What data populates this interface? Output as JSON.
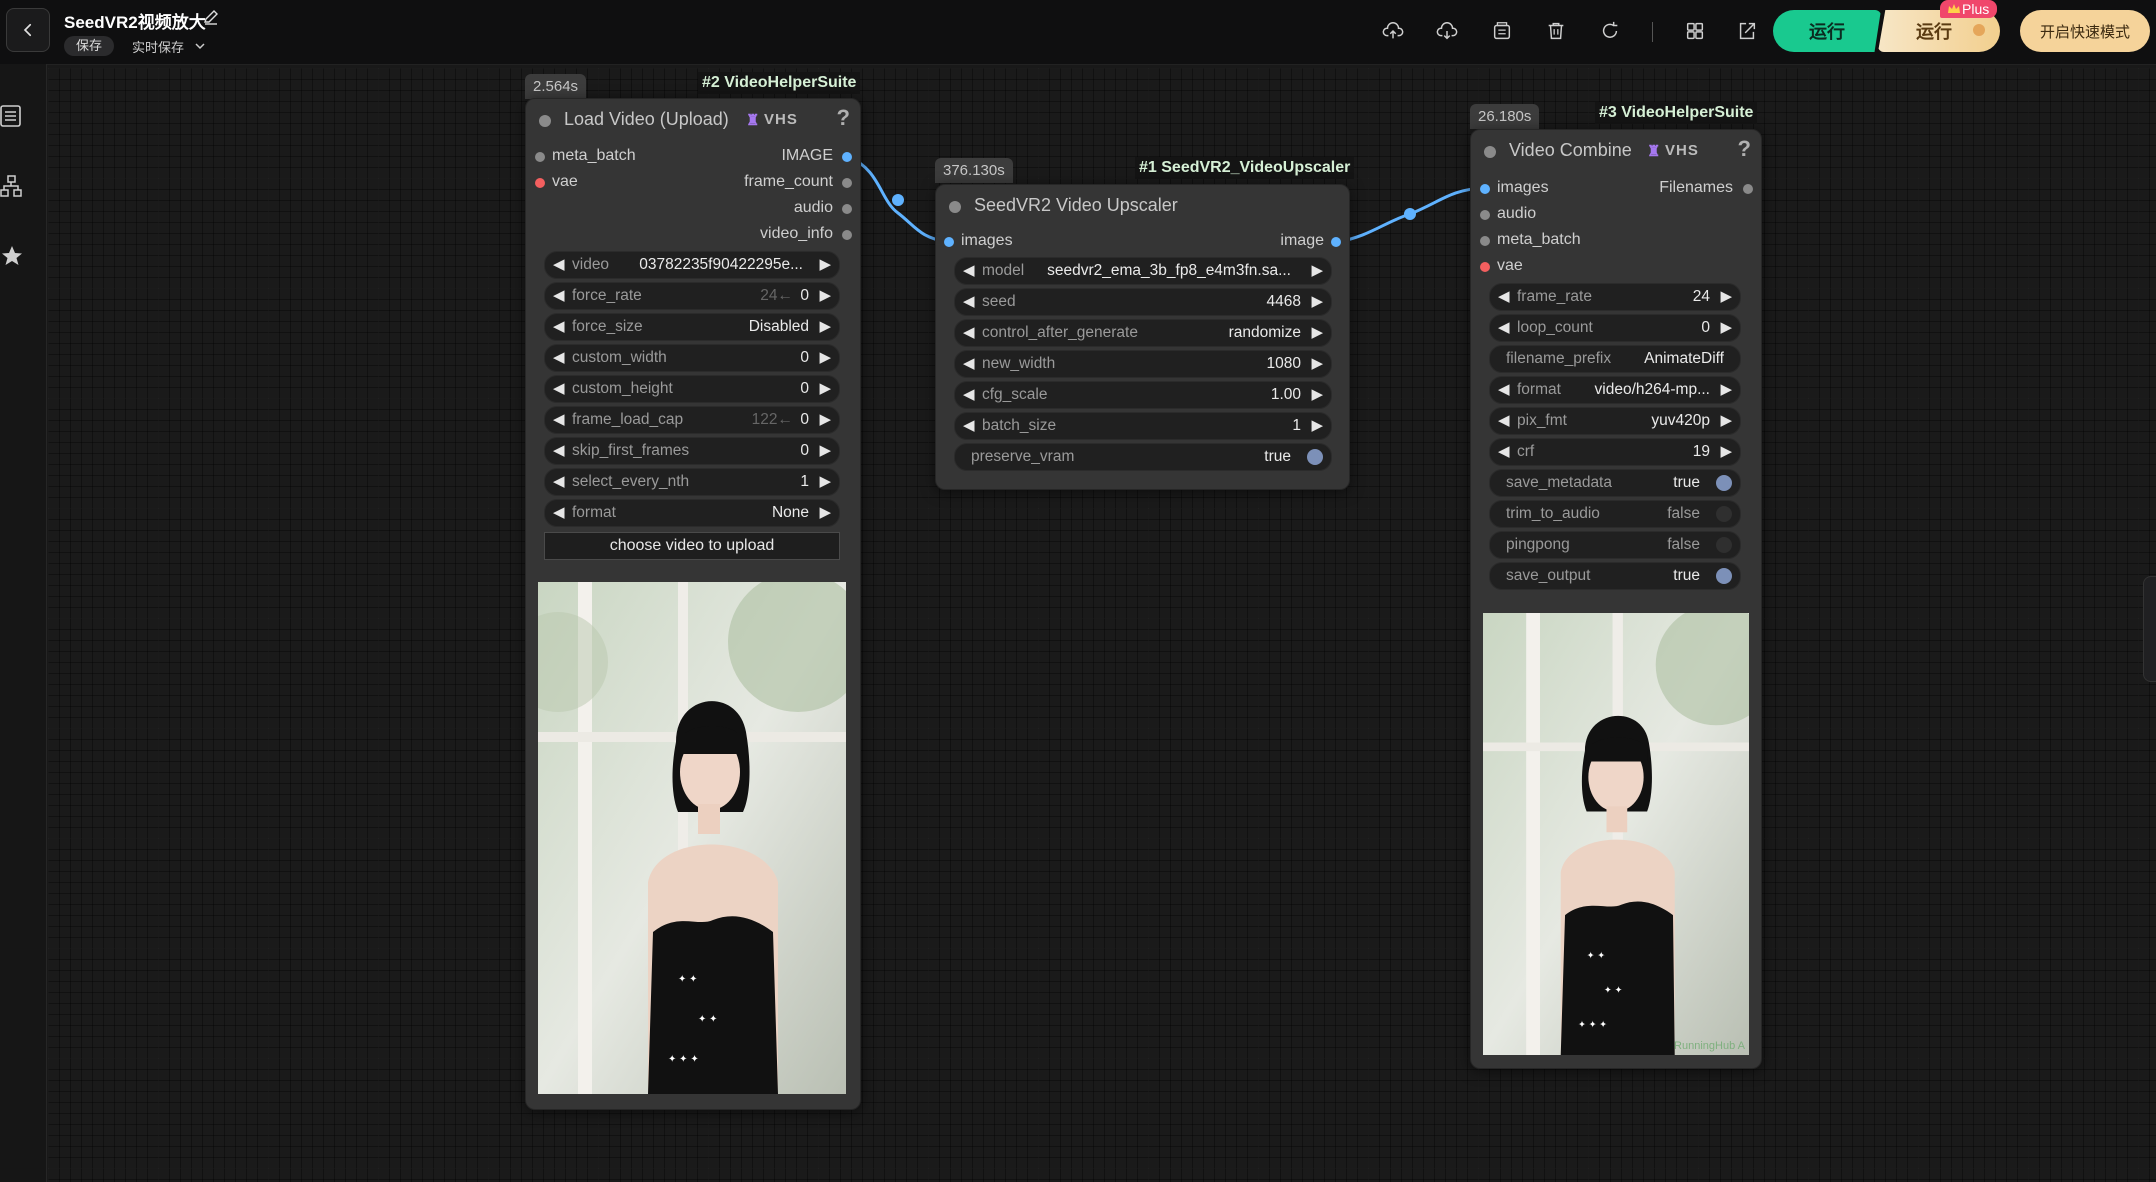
{
  "topbar": {
    "title": "SeedVR2视频放大",
    "save_label": "保存",
    "autosave_label": "实时保存",
    "run_label": "运行",
    "run_plus_label": "运行",
    "plus_badge": "Plus",
    "quick_mode_label": "开启快速模式",
    "tool_icons": [
      "upload-icon",
      "download-icon",
      "library-icon",
      "trash-icon",
      "refresh-icon",
      "grid-icon",
      "export-icon"
    ]
  },
  "colors": {
    "accent_run": "#19c98f",
    "plus_gold": "#f5d39a",
    "link_blue": "#5fb2ff",
    "socket_red": "#f35f5f"
  },
  "sidebar": {
    "icons": [
      "list-icon",
      "hierarchy-icon",
      "star-icon"
    ]
  },
  "nodes": {
    "load_video": {
      "timer": "2.564s",
      "tag": "#2 VideoHelperSuite",
      "title": "Load Video (Upload)",
      "badge": "VHS",
      "inputs": [
        "meta_batch",
        "vae"
      ],
      "outputs": [
        "IMAGE",
        "frame_count",
        "audio",
        "video_info"
      ],
      "widgets": [
        {
          "label": "video",
          "value": "03782235f90422295e..."
        },
        {
          "label": "force_rate",
          "hint": "24←",
          "value": "0"
        },
        {
          "label": "force_size",
          "value": "Disabled"
        },
        {
          "label": "custom_width",
          "value": "0"
        },
        {
          "label": "custom_height",
          "value": "0"
        },
        {
          "label": "frame_load_cap",
          "hint": "122←",
          "value": "0"
        },
        {
          "label": "skip_first_frames",
          "value": "0"
        },
        {
          "label": "select_every_nth",
          "value": "1"
        },
        {
          "label": "format",
          "value": "None"
        }
      ],
      "upload_label": "choose video to upload"
    },
    "upscaler": {
      "timer": "376.130s",
      "tag": "#1 SeedVR2_VideoUpscaler",
      "title": "SeedVR2 Video Upscaler",
      "input": "images",
      "output": "image",
      "widgets": [
        {
          "label": "model",
          "value": "seedvr2_ema_3b_fp8_e4m3fn.sa..."
        },
        {
          "label": "seed",
          "value": "4468"
        },
        {
          "label": "control_after_generate",
          "value": "randomize"
        },
        {
          "label": "new_width",
          "value": "1080"
        },
        {
          "label": "cfg_scale",
          "value": "1.00"
        },
        {
          "label": "batch_size",
          "value": "1"
        }
      ],
      "toggle": {
        "label": "preserve_vram",
        "value": "true"
      }
    },
    "video_combine": {
      "timer": "26.180s",
      "tag": "#3 VideoHelperSuite",
      "title": "Video Combine",
      "badge": "VHS",
      "inputs": [
        "images",
        "audio",
        "meta_batch",
        "vae"
      ],
      "output": "Filenames",
      "widgets": [
        {
          "label": "frame_rate",
          "value": "24"
        },
        {
          "label": "loop_count",
          "value": "0"
        },
        {
          "label": "filename_prefix",
          "value": "AnimateDiff"
        },
        {
          "label": "format",
          "value": "video/h264-mp..."
        },
        {
          "label": "pix_fmt",
          "value": "yuv420p"
        },
        {
          "label": "crf",
          "value": "19"
        }
      ],
      "toggles": [
        {
          "label": "save_metadata",
          "value": "true"
        },
        {
          "label": "trim_to_audio",
          "value": "false"
        },
        {
          "label": "pingpong",
          "value": "false"
        },
        {
          "label": "save_output",
          "value": "true"
        }
      ],
      "watermark": "RunningHub A"
    }
  }
}
